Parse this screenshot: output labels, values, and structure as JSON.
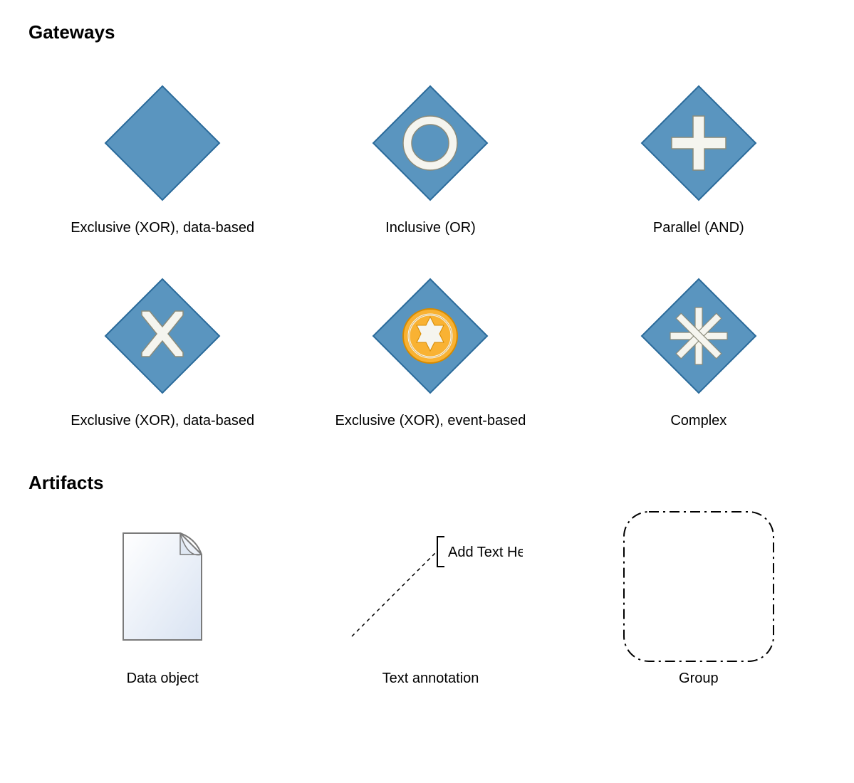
{
  "sections": {
    "gateways_title": "Gateways",
    "artifacts_title": "Artifacts"
  },
  "gateways": {
    "row1": [
      {
        "label": "Exclusive (XOR), data-based"
      },
      {
        "label": "Inclusive (OR)"
      },
      {
        "label": "Parallel (AND)"
      }
    ],
    "row2": [
      {
        "label": "Exclusive (XOR), data-based"
      },
      {
        "label": "Exclusive (XOR), event-based"
      },
      {
        "label": "Complex"
      }
    ]
  },
  "artifacts": {
    "items": [
      {
        "label": "Data object"
      },
      {
        "label": "Text annotation"
      },
      {
        "label": "Group"
      }
    ],
    "annotation_text": "Add Text Here"
  },
  "colors": {
    "diamond_fill": "#5A95BF",
    "diamond_stroke": "#2A6A9A",
    "marker_fill": "#F5F5EF",
    "marker_stroke": "#8B8B7A",
    "event_circle_fill": "#F9B233",
    "event_circle_stroke": "#D68A00",
    "paper_fill": "#E8EEF7",
    "paper_stroke": "#7A7A7A"
  }
}
